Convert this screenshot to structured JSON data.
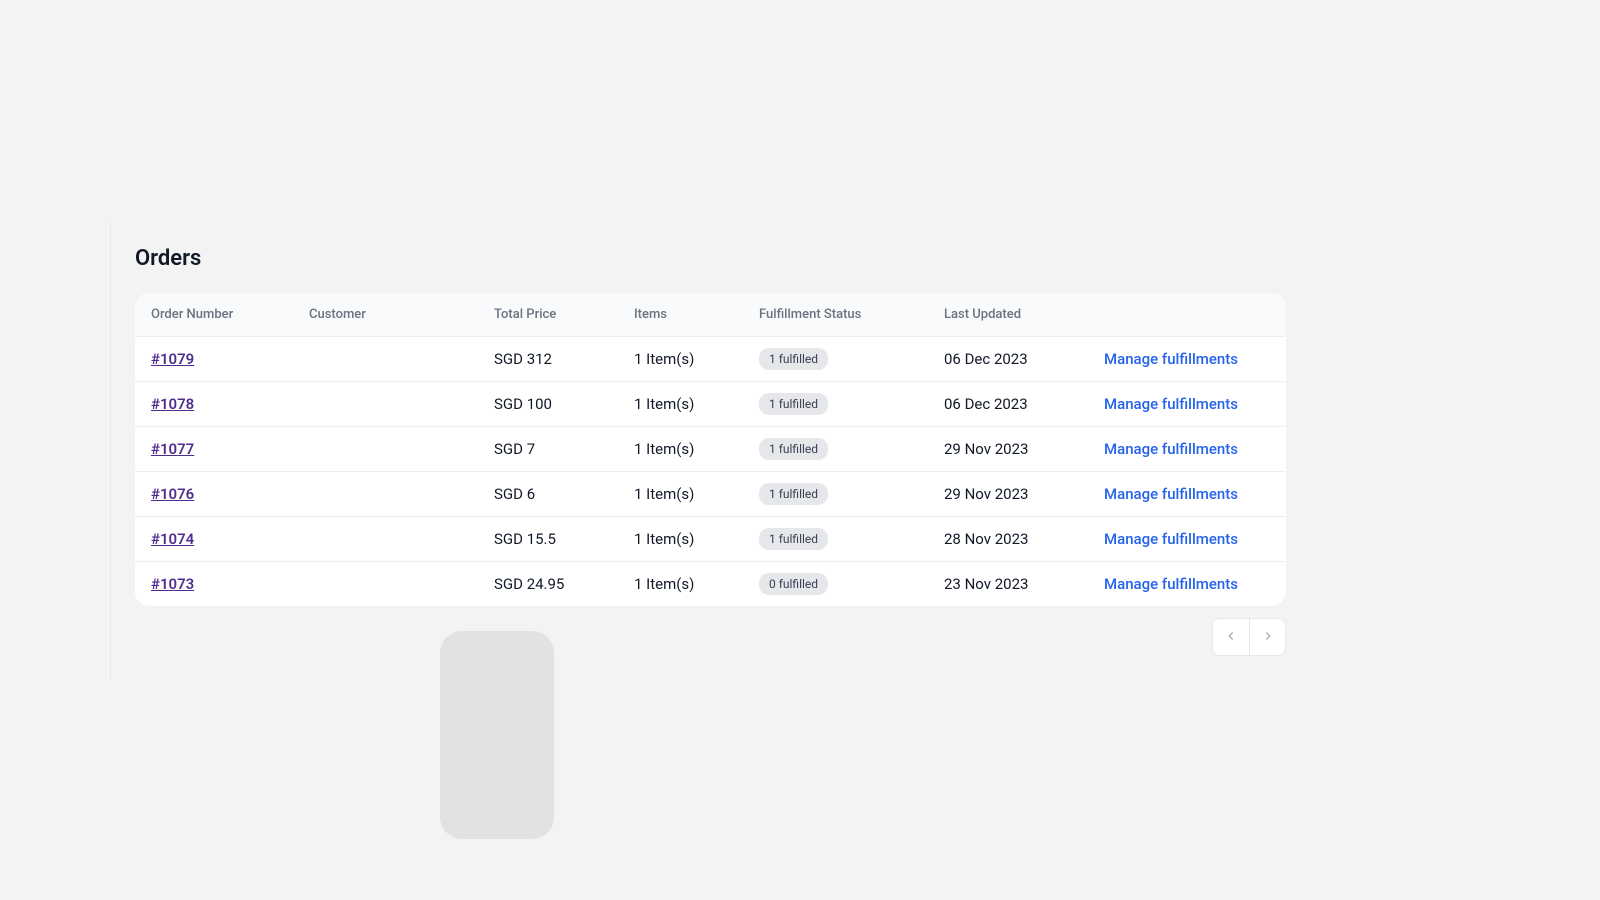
{
  "page": {
    "title": "Orders"
  },
  "table": {
    "columns": {
      "order_number": "Order Number",
      "customer": "Customer",
      "total_price": "Total Price",
      "items": "Items",
      "fulfillment_status": "Fulfillment Status",
      "last_updated": "Last Updated",
      "action": ""
    },
    "rows": [
      {
        "order_number": "#1079",
        "total_price": "SGD 312",
        "items": "1 Item(s)",
        "fulfillment_status": "1 fulfilled",
        "last_updated": "06 Dec 2023",
        "action": "Manage fulfillments"
      },
      {
        "order_number": "#1078",
        "total_price": "SGD 100",
        "items": "1 Item(s)",
        "fulfillment_status": "1 fulfilled",
        "last_updated": "06 Dec 2023",
        "action": "Manage fulfillments"
      },
      {
        "order_number": "#1077",
        "total_price": "SGD 7",
        "items": "1 Item(s)",
        "fulfillment_status": "1 fulfilled",
        "last_updated": "29 Nov 2023",
        "action": "Manage fulfillments"
      },
      {
        "order_number": "#1076",
        "total_price": "SGD 6",
        "items": "1 Item(s)",
        "fulfillment_status": "1 fulfilled",
        "last_updated": "29 Nov 2023",
        "action": "Manage fulfillments"
      },
      {
        "order_number": "#1074",
        "total_price": "SGD 15.5",
        "items": "1 Item(s)",
        "fulfillment_status": "1 fulfilled",
        "last_updated": "28 Nov 2023",
        "action": "Manage fulfillments"
      },
      {
        "order_number": "#1073",
        "total_price": "SGD 24.95",
        "items": "1 Item(s)",
        "fulfillment_status": "0 fulfilled",
        "last_updated": "23 Nov 2023",
        "action": "Manage fulfillments"
      }
    ]
  }
}
